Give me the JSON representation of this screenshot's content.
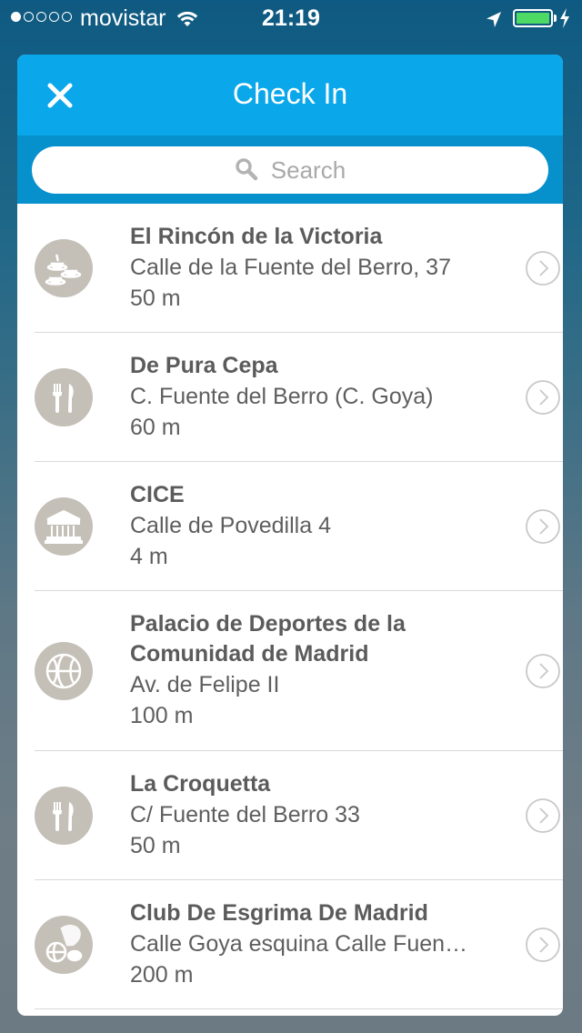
{
  "status_bar": {
    "carrier": "movistar",
    "time": "21:19",
    "signal_strength": "1/5",
    "battery_level": 1.0
  },
  "header": {
    "title": "Check In",
    "close_icon": "close-icon",
    "background_color": "#0aa8ea"
  },
  "search": {
    "placeholder": "Search",
    "icon": "search-icon"
  },
  "venues": [
    {
      "name": "El Rincón de la Victoria",
      "address": "Calle de la Fuente del Berro, 37",
      "distance": "50 m",
      "icon": "cafe-icon"
    },
    {
      "name": "De Pura Cepa",
      "address": "C. Fuente del Berro (C. Goya)",
      "distance": "60 m",
      "icon": "fork-knife-icon"
    },
    {
      "name": "CICE",
      "address": "Calle de Povedilla 4",
      "distance": "4 m",
      "icon": "building-icon"
    },
    {
      "name": "Palacio de Deportes de la Comunidad de Madrid",
      "address": "Av. de Felipe II",
      "distance": "100 m",
      "icon": "basketball-icon"
    },
    {
      "name": "La Croquetta",
      "address": "C/ Fuente del Berro 33",
      "distance": "50 m",
      "icon": "fork-knife-icon"
    },
    {
      "name": "Club De Esgrima De Madrid",
      "address": "Calle Goya esquina Calle Fuen…",
      "distance": "200 m",
      "icon": "sports-icon"
    }
  ]
}
